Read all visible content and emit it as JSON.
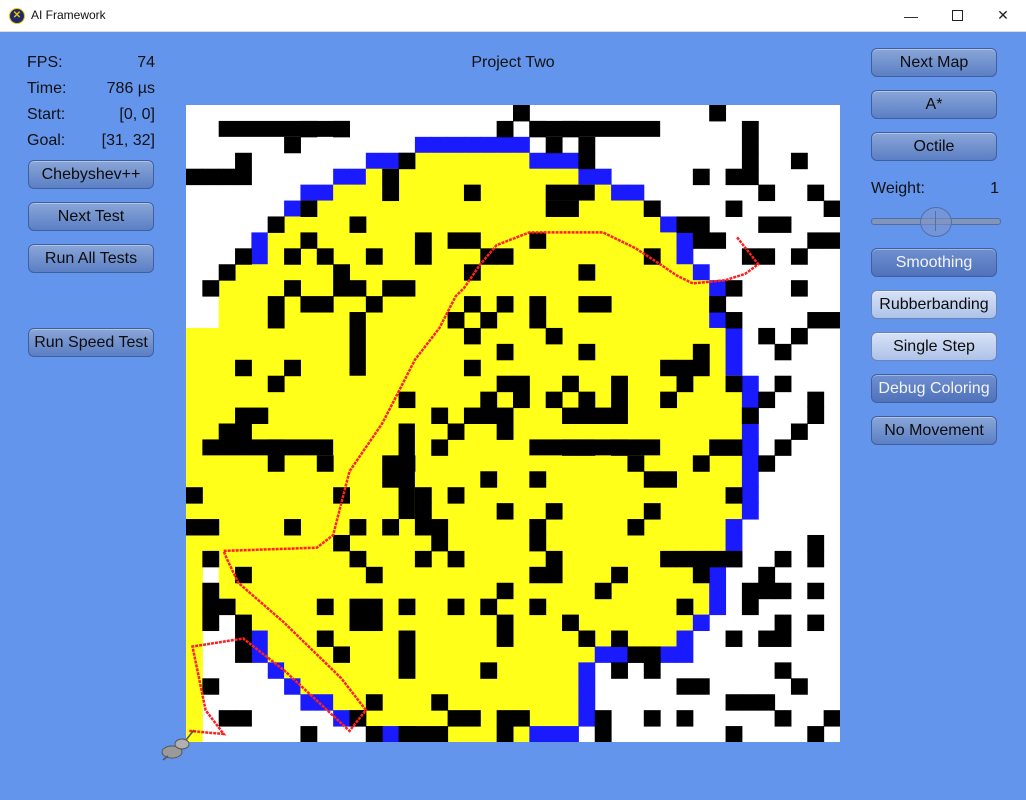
{
  "window": {
    "title": "AI Framework",
    "minimize": "—",
    "close": "✕"
  },
  "stats": [
    {
      "label": "FPS:",
      "value": "74"
    },
    {
      "label": "Time:",
      "value": "786 µs"
    },
    {
      "label": "Start:",
      "value": "[0, 0]"
    },
    {
      "label": "Goal:",
      "value": "[31, 32]"
    }
  ],
  "left_buttons": {
    "heuristic": "Chebyshev++",
    "next_test": "Next Test",
    "run_all_tests": "Run All Tests",
    "run_speed_test": "Run Speed Test"
  },
  "project_title": "Project Two",
  "right_buttons": {
    "next_map": "Next Map",
    "algorithm": "A*",
    "distance": "Octile",
    "smoothing": "Smoothing",
    "rubberbanding": "Rubberbanding",
    "single_step": "Single Step",
    "debug_coloring": "Debug Coloring",
    "no_movement": "No Movement"
  },
  "weight": {
    "label": "Weight:",
    "value": "1",
    "slider_fraction": 0.5
  },
  "map": {
    "columns": 40,
    "rows": 40,
    "colors": {
      "open": "#ffffff",
      "closed": "#ffff1a",
      "frontier": "#1a1aff",
      "wall": "#000000",
      "path": "#ff2020"
    }
  },
  "colors": {
    "background": "#6495ED",
    "button": "#5b7fc4",
    "button_on": "#c3d3ef"
  }
}
